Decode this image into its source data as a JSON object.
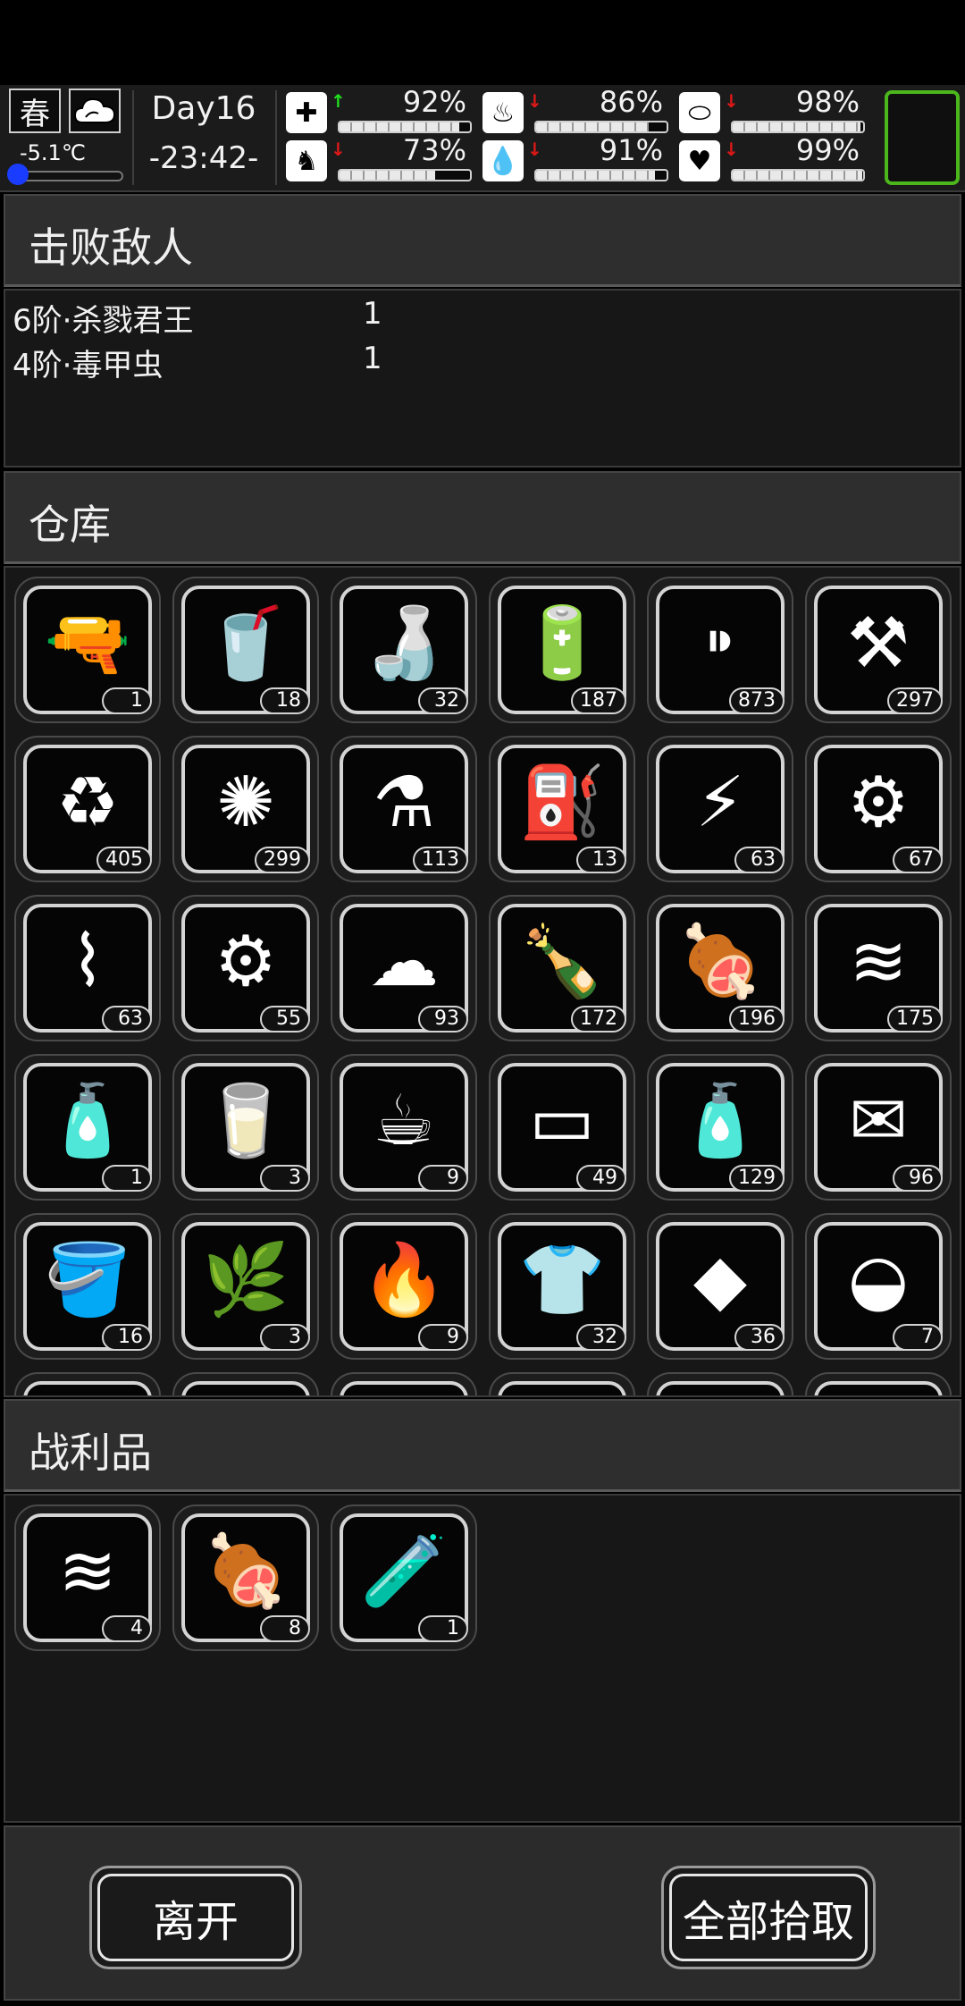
{
  "status": {
    "season": "春",
    "weather_icon": "cloud-icon",
    "temperature": "-5.1℃",
    "temperature_level": 0.05,
    "day": "Day16",
    "clock": "-23:42-",
    "stats": [
      {
        "icon": "medkit-icon",
        "glyph": "✚",
        "trend": "up",
        "arrow": "↑",
        "value": "92%",
        "level": 0.92
      },
      {
        "icon": "stomach-icon",
        "glyph": "♨",
        "trend": "down",
        "arrow": "↓",
        "value": "86%",
        "level": 0.86
      },
      {
        "icon": "pill-icon",
        "glyph": "⬭",
        "trend": "down",
        "arrow": "↓",
        "value": "98%",
        "level": 0.98
      },
      {
        "icon": "foot-icon",
        "glyph": "♞",
        "trend": "down",
        "arrow": "↓",
        "value": "73%",
        "level": 0.73
      },
      {
        "icon": "water-drop-icon",
        "glyph": "💧",
        "trend": "down",
        "arrow": "↓",
        "value": "91%",
        "level": 0.91
      },
      {
        "icon": "heart-icon",
        "glyph": "♥",
        "trend": "down",
        "arrow": "↓",
        "value": "99%",
        "level": 0.99
      }
    ]
  },
  "defeated": {
    "title": "击败敌人",
    "enemies": [
      {
        "name": "6阶·杀戮君王",
        "count": "1"
      },
      {
        "name": "4阶·毒甲虫",
        "count": "1"
      }
    ]
  },
  "warehouse": {
    "title": "仓库",
    "items": [
      {
        "icon": "flare-gun-icon",
        "glyph": "🔫",
        "count": "1"
      },
      {
        "icon": "cola-cup-icon",
        "glyph": "🥤",
        "count": "18"
      },
      {
        "icon": "water-bottle-icon",
        "glyph": "🍶",
        "count": "32"
      },
      {
        "icon": "battery-icon",
        "glyph": "🔋",
        "count": "187"
      },
      {
        "icon": "bullets-icon",
        "glyph": "⁍",
        "count": "873"
      },
      {
        "icon": "scrap-metal-icon",
        "glyph": "⚒",
        "count": "297"
      },
      {
        "icon": "plastic-bottle-icon",
        "glyph": "♻",
        "count": "405"
      },
      {
        "icon": "fiber-icon",
        "glyph": "✺",
        "count": "299"
      },
      {
        "icon": "flask-icon",
        "glyph": "⚗",
        "count": "113"
      },
      {
        "icon": "fuel-can-icon",
        "glyph": "⛽",
        "count": "13"
      },
      {
        "icon": "aa-battery-icon",
        "glyph": "⚡",
        "count": "63"
      },
      {
        "icon": "gears-icon",
        "glyph": "⚙",
        "count": "67"
      },
      {
        "icon": "wire-icon",
        "glyph": "⌇",
        "count": "63"
      },
      {
        "icon": "electronic-parts-icon",
        "glyph": "⚙",
        "count": "55"
      },
      {
        "icon": "cotton-icon",
        "glyph": "☁",
        "count": "93"
      },
      {
        "icon": "glass-bottle-icon",
        "glyph": "🍾",
        "count": "172"
      },
      {
        "icon": "meat-icon",
        "glyph": "🍖",
        "count": "196"
      },
      {
        "icon": "cloth-icon",
        "glyph": "≋",
        "count": "175"
      },
      {
        "icon": "spray-can-icon",
        "glyph": "🧴",
        "count": "1"
      },
      {
        "icon": "juice-glass-icon",
        "glyph": "🥛",
        "count": "3"
      },
      {
        "icon": "coffee-cup-icon",
        "glyph": "☕",
        "count": "9"
      },
      {
        "icon": "board-icon",
        "glyph": "▭",
        "count": "49"
      },
      {
        "icon": "spray-bottle-icon",
        "glyph": "🧴",
        "count": "129"
      },
      {
        "icon": "paper-icon",
        "glyph": "✉",
        "count": "96"
      },
      {
        "icon": "bucket-icon",
        "glyph": "🪣",
        "count": "16"
      },
      {
        "icon": "herb-jug-icon",
        "glyph": "🌿",
        "count": "3"
      },
      {
        "icon": "fire-barrel-icon",
        "glyph": "🔥",
        "count": "9"
      },
      {
        "icon": "tattered-clothes-icon",
        "glyph": "👕",
        "count": "32"
      },
      {
        "icon": "rock-icon",
        "glyph": "◆",
        "count": "36"
      },
      {
        "icon": "mushroom-icon",
        "glyph": "◒",
        "count": "7"
      }
    ]
  },
  "loot": {
    "title": "战利品",
    "items": [
      {
        "icon": "cloth-icon",
        "glyph": "≋",
        "count": "4"
      },
      {
        "icon": "meat-icon",
        "glyph": "🍖",
        "count": "8"
      },
      {
        "icon": "test-tube-vi-icon",
        "glyph": "🧪",
        "count": "1"
      }
    ]
  },
  "actions": {
    "leave": "离开",
    "take_all": "全部拾取"
  }
}
